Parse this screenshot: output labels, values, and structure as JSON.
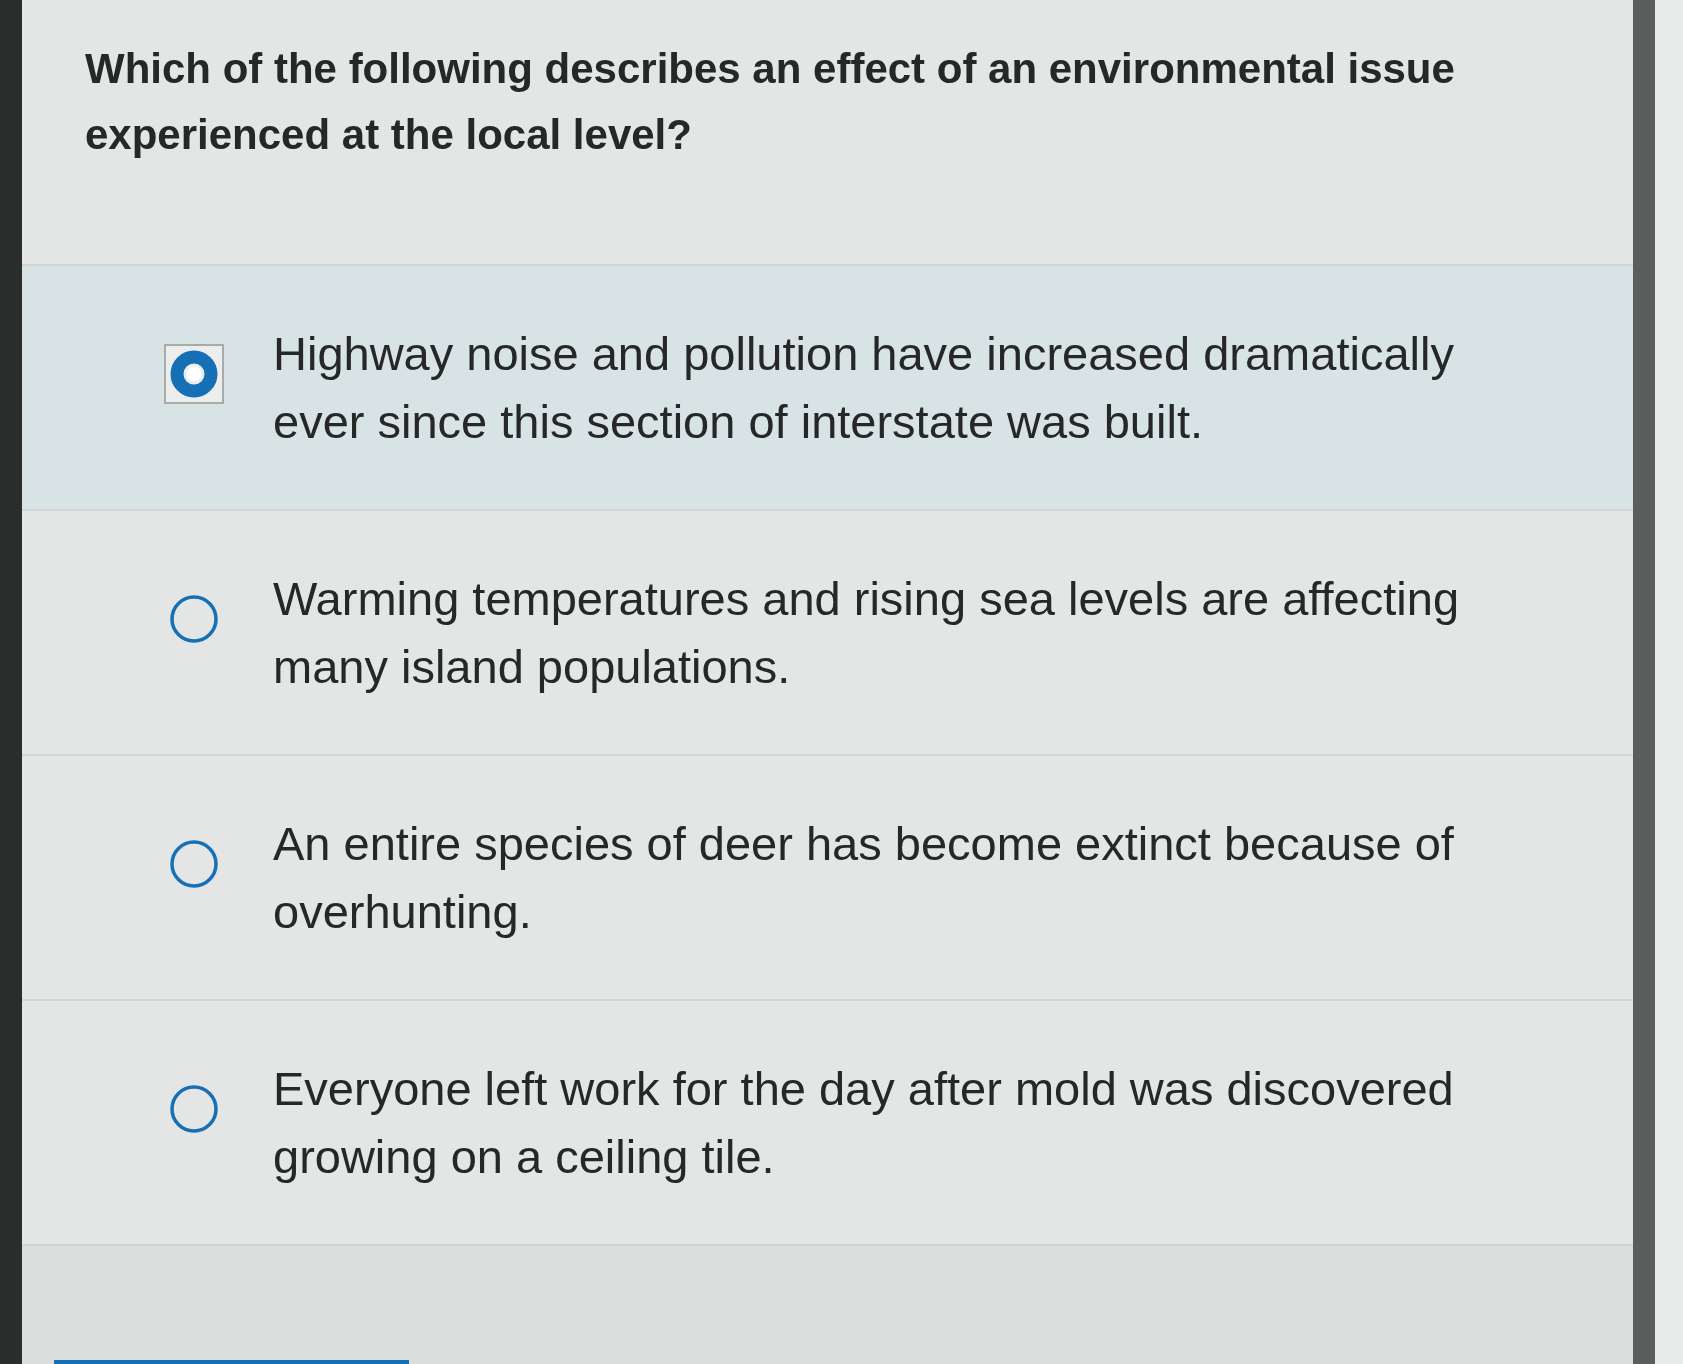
{
  "question": "Which of the following describes an effect of an environmental issue experienced at the local level?",
  "options": [
    {
      "text": "Highway noise and pollution have increased dramatically ever since this section of interstate was built.",
      "selected": true
    },
    {
      "text": "Warming temperatures and rising sea levels are affecting many island populations.",
      "selected": false
    },
    {
      "text": "An entire species of deer has become extinct because of overhunting.",
      "selected": false
    },
    {
      "text": "Everyone left work for the day after mold was discovered growing on a ceiling tile.",
      "selected": false
    }
  ]
}
